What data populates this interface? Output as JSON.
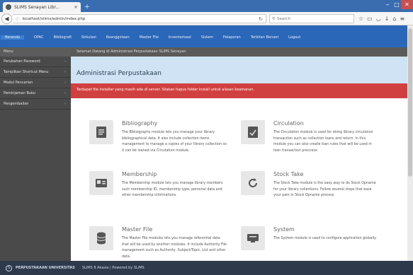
{
  "browser": {
    "tab_title": "SLiMS Senayan Libr...",
    "tab_close": "×",
    "new_tab": "+",
    "url": "localhost/slims/admin/index.php",
    "search_placeholder": "Search",
    "window_controls": [
      "‒",
      "□",
      "✕"
    ]
  },
  "app": {
    "menu": [
      "Beranda",
      "OPAC",
      "Bibliografi",
      "Sirkulasi",
      "Keanggotaan",
      "Master File",
      "Inventarisasi",
      "Sistem",
      "Pelaporan",
      "Terbitan Berseri",
      "Logout"
    ],
    "active_menu_index": 0
  },
  "sidebar": {
    "header": "Menu",
    "items": [
      "Perubahan Password",
      "Tampilkan Shortcut Menu",
      "Modul Pencarian",
      "Peminjaman Buku",
      "Pengembalian"
    ]
  },
  "breadcrumb": "Selamat Datang di Administrasi Perpustakaan SLiMS Senayan",
  "main": {
    "page_title": "Administrasi Perpustakaan",
    "alert": "Terdapat file installer yang masih ada di server. Silakan hapus folder install untuk alasan keamanan.",
    "modules": [
      {
        "title": "Bibliography",
        "icon": "bibliography-icon",
        "description": "The Bibliography module lets you manage your library bibliographical data. It also include collection items management to manage a copies of your library collection so it can be loaned via Circulation module."
      },
      {
        "title": "Circulation",
        "icon": "circulation-icon",
        "description": "The Circulation module is used for doing library circulation transaction such as collection loans and return. In this module you can also create loan rules that will be used in loan transaction proccess."
      },
      {
        "title": "Membership",
        "icon": "membership-icon",
        "description": "The Membership module lets you manage library members such membership ID, membership type, personal data and other membership informations."
      },
      {
        "title": "Stock Take",
        "icon": "stocktake-icon",
        "description": "The Stock Take module is the easy way to do Stock Opname for your library collections. Follow several steps that ease your pain in Stock Opname process."
      },
      {
        "title": "Master File",
        "icon": "masterfile-icon",
        "description": "The Master File modules lets you manage referential data that will be used by another modules. It include Authority File management such as Authority, Subject/Topic, List and other data."
      },
      {
        "title": "System",
        "icon": "system-icon",
        "description": "The System module is used to configure application globally."
      }
    ]
  },
  "footer": {
    "brand": "PERPUSTAKAAN UNIVERSITAS",
    "version": "SLiMS 8 Akasia | Powered by SLiMS"
  },
  "colors": {
    "header_blue": "#2b67b8",
    "sidebar_gray": "#4a4a4a",
    "alert_red": "#d14040",
    "title_bar": "#cfe3f4",
    "footer": "#2e3a4c"
  }
}
